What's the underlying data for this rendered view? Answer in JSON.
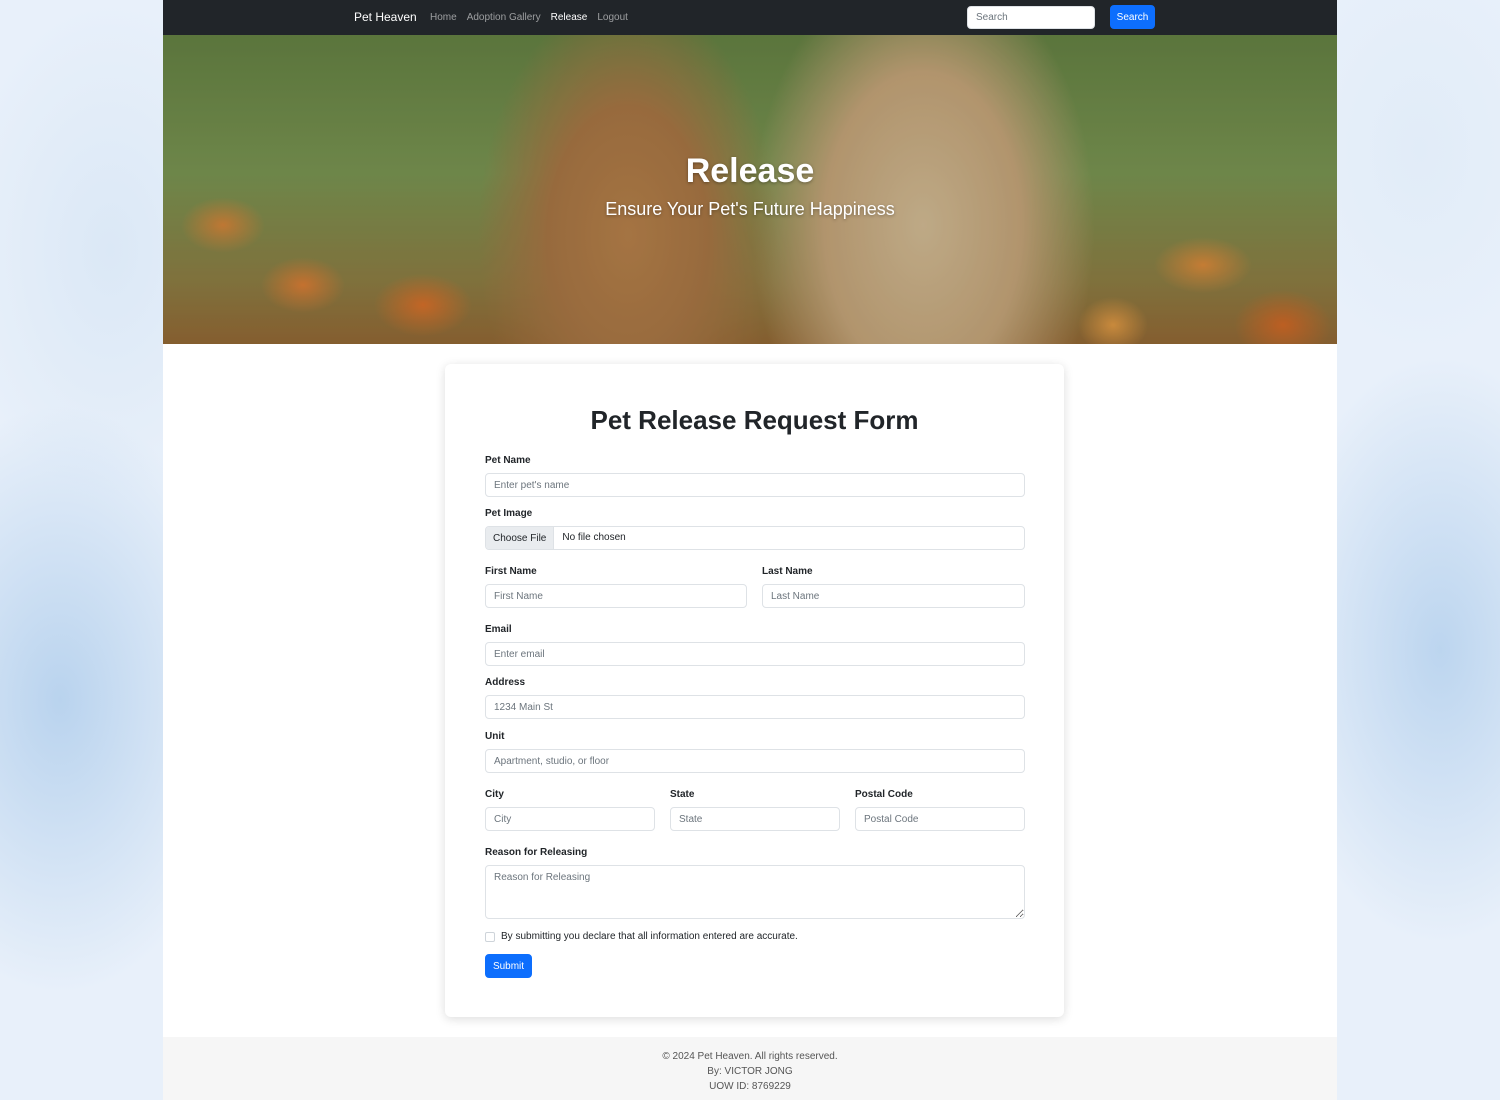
{
  "navbar": {
    "brand": "Pet Heaven",
    "links": [
      {
        "label": "Home",
        "active": false
      },
      {
        "label": "Adoption Gallery",
        "active": false
      },
      {
        "label": "Release",
        "active": true
      },
      {
        "label": "Logout",
        "active": false
      }
    ],
    "search_placeholder": "Search",
    "search_button": "Search"
  },
  "hero": {
    "title": "Release",
    "subtitle": "Ensure Your Pet's Future Happiness"
  },
  "form": {
    "title": "Pet Release Request Form",
    "pet_name": {
      "label": "Pet Name",
      "placeholder": "Enter pet's name"
    },
    "pet_image": {
      "label": "Pet Image",
      "button": "Choose File",
      "status": "No file chosen"
    },
    "first_name": {
      "label": "First Name",
      "placeholder": "First Name"
    },
    "last_name": {
      "label": "Last Name",
      "placeholder": "Last Name"
    },
    "email": {
      "label": "Email",
      "placeholder": "Enter email"
    },
    "address": {
      "label": "Address",
      "placeholder": "1234 Main St"
    },
    "unit": {
      "label": "Unit",
      "placeholder": "Apartment, studio, or floor"
    },
    "city": {
      "label": "City",
      "placeholder": "City"
    },
    "state": {
      "label": "State",
      "placeholder": "State"
    },
    "postal_code": {
      "label": "Postal Code",
      "placeholder": "Postal Code"
    },
    "reason": {
      "label": "Reason for Releasing",
      "placeholder": "Reason for Releasing"
    },
    "declaration": "By submitting you declare that all information entered are accurate.",
    "submit": "Submit"
  },
  "footer": {
    "copyright": "© 2024 Pet Heaven. All rights reserved.",
    "author": "By: VICTOR JONG",
    "uow_id": "UOW ID: 8769229"
  },
  "colors": {
    "navbar_bg": "#212529",
    "primary": "#0d6efd",
    "footer_bg": "#f6f6f6"
  }
}
